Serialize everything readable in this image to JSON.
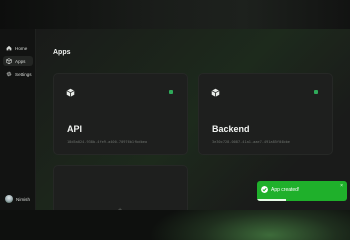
{
  "sidebar": {
    "items": [
      {
        "label": "Home",
        "icon": "home-icon"
      },
      {
        "label": "Apps",
        "icon": "apps-icon",
        "active": true
      },
      {
        "label": "Settings",
        "icon": "gear-icon"
      }
    ],
    "user": {
      "name": "Nimish"
    }
  },
  "main": {
    "title": "Apps",
    "cards": [
      {
        "name": "API",
        "id": "18d5a024-938b-4fe9-a400-70976b1fbdbea",
        "status_color": "#2faa5a"
      },
      {
        "name": "Backend",
        "id": "3e30c728-0087-41a1-aae7-491a85f04bbe",
        "status_color": "#2faa5a"
      }
    ],
    "new_card": {
      "icon": "plus-icon"
    }
  },
  "toast": {
    "message": "App created!",
    "icon": "check-circle-icon",
    "close_icon": "close-icon",
    "color": "#1fb02b",
    "progress": 0.32
  }
}
